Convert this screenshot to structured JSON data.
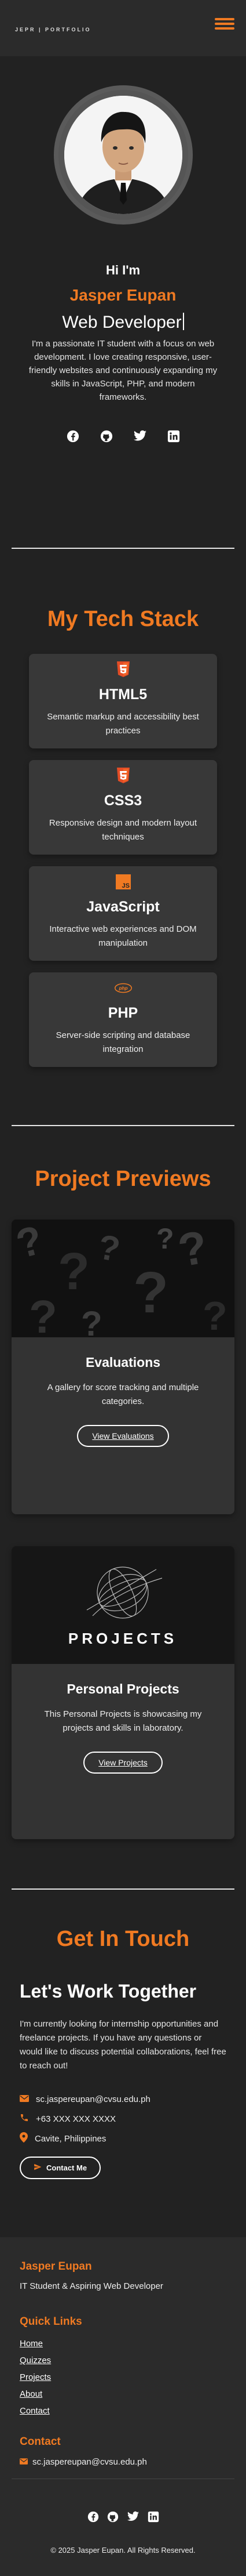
{
  "brand": {
    "logo_text": "JEPR | PORTFOLIO",
    "accent": "#f07a22",
    "background": "#222222"
  },
  "nav": {
    "menu_icon": "hamburger-icon"
  },
  "hero": {
    "greeting": "Hi I'm",
    "name": "Jasper Eupan",
    "role": "Web Developer",
    "bio": "I'm a passionate IT student with a focus on web development. I love creating responsive, user-friendly websites and continuously expanding my skills in JavaScript, PHP, and modern frameworks.",
    "socials": [
      "facebook-icon",
      "github-icon",
      "twitter-icon",
      "linkedin-icon"
    ]
  },
  "tech": {
    "title": "My Tech Stack",
    "items": [
      {
        "name": "HTML5",
        "desc": "Semantic markup and accessibility best practices",
        "icon": "html5-icon"
      },
      {
        "name": "CSS3",
        "desc": "Responsive design and modern layout techniques",
        "icon": "css3-icon"
      },
      {
        "name": "JavaScript",
        "desc": "Interactive web experiences and DOM manipulation",
        "icon": "javascript-icon"
      },
      {
        "name": "PHP",
        "desc": "Server-side scripting and database integration",
        "icon": "php-icon"
      }
    ]
  },
  "projects": {
    "title": "Project Previews",
    "items": [
      {
        "name": "Evaluations",
        "desc": "A gallery for score tracking and multiple categories.",
        "button": "View Evaluations"
      },
      {
        "name": "Personal Projects",
        "desc": "This Personal Projects is showcasing my projects and skills in laboratory.",
        "button": "View Projects",
        "image_text": "PROJECTS"
      }
    ]
  },
  "contact": {
    "title": "Get In Touch",
    "heading": "Let's Work Together",
    "text": "I'm currently looking for internship opportunities and freelance projects. If you have any questions or would like to discuss potential collaborations, feel free to reach out!",
    "email": "sc.jaspereupan@cvsu.edu.ph",
    "phone": "+63 XXX XXX XXXX",
    "location": "Cavite, Philippines",
    "button": "Contact Me"
  },
  "footer": {
    "name": "Jasper Eupan",
    "tagline": "IT Student & Aspiring Web Developer",
    "quick_links_title": "Quick Links",
    "links": [
      "Home",
      "Quizzes",
      "Projects",
      "About",
      "Contact"
    ],
    "contact_title": "Contact",
    "email": "sc.jaspereupan@cvsu.edu.ph",
    "copyright": "© 2025 Jasper Eupan. All Rights Reserved."
  }
}
